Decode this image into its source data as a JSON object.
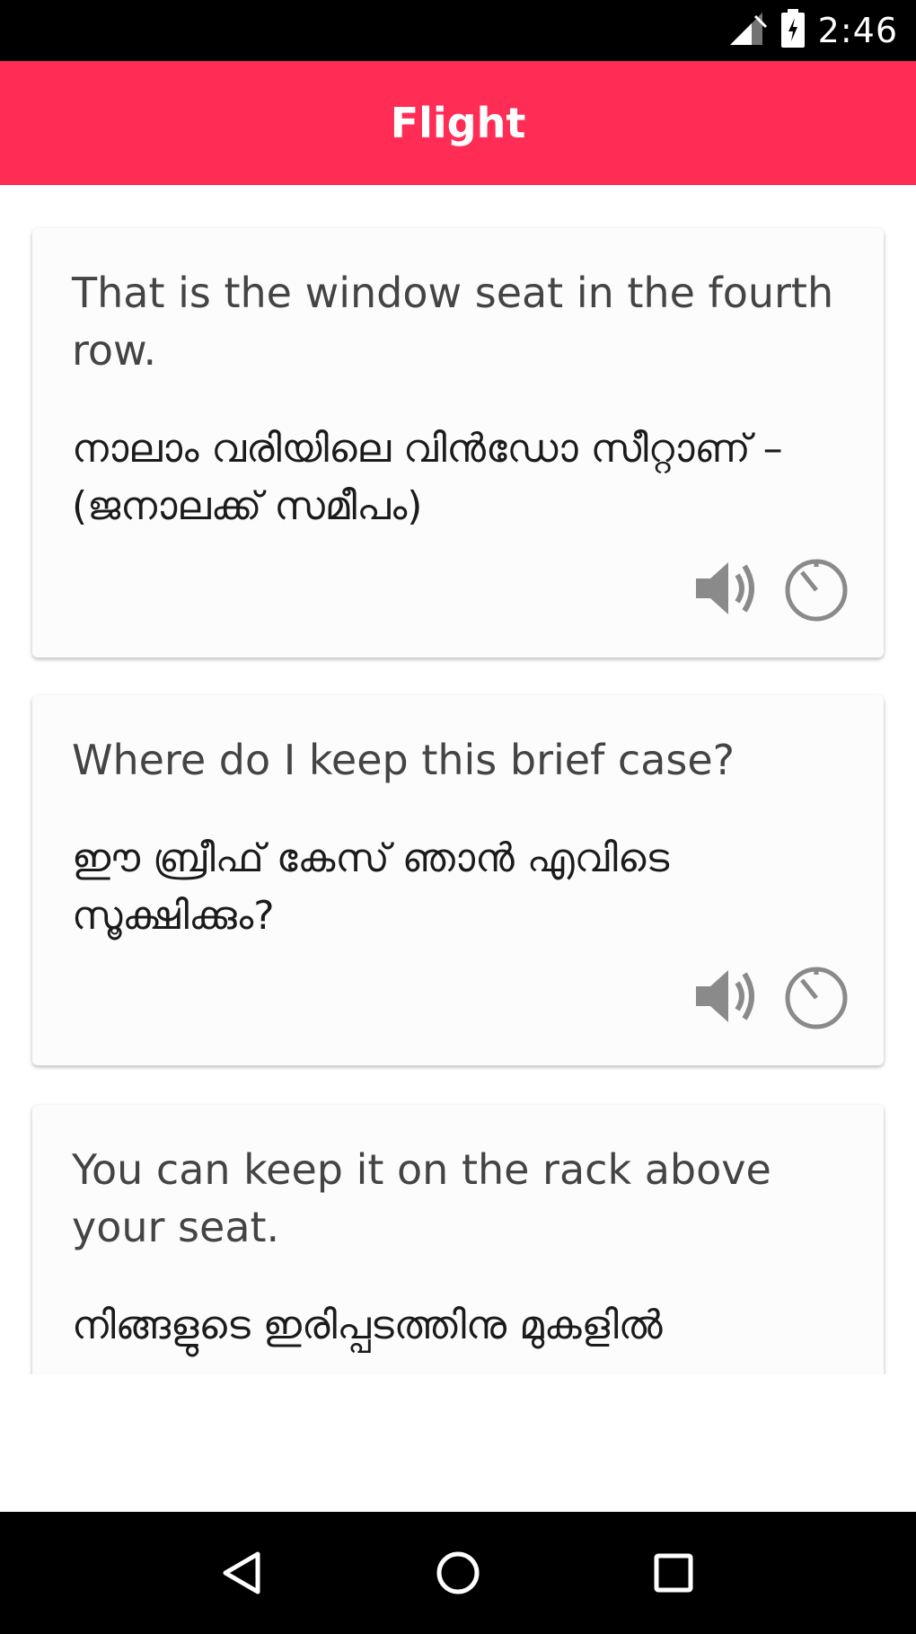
{
  "status_bar": {
    "time": "2:46",
    "icons": [
      "signal-icon",
      "battery-icon"
    ]
  },
  "app_bar": {
    "title": "Flight",
    "color": "#ff2d55"
  },
  "cards": [
    {
      "english": "That is the window seat in the fourth row.",
      "malayalam": "നാലാം വരിയിലെ വിൻഡോ സീറ്റാണ് – (ജനാലക്ക് സമീപം)",
      "actions": [
        "speaker-icon",
        "timer-icon"
      ]
    },
    {
      "english": "Where do I keep this brief case?",
      "malayalam": "ഈ ബ്രീഫ് കേസ് ഞാൻ എവിടെ സൂക്ഷിക്കും?",
      "actions": [
        "speaker-icon",
        "timer-icon"
      ]
    },
    {
      "english": "You can keep it on the rack above your seat.",
      "malayalam": "നിങ്ങളുടെ ഇരിപ്പടത്തിനു മുകളിൽ",
      "actions": []
    }
  ],
  "nav_bar": {
    "buttons": [
      "back-icon",
      "home-icon",
      "recents-icon"
    ]
  }
}
